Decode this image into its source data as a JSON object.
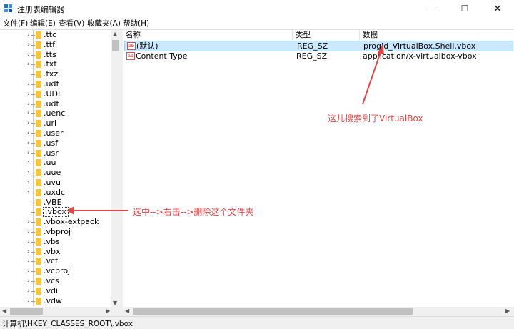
{
  "window": {
    "title": "注册表编辑器",
    "minimize_glyph": "—",
    "maximize_glyph": "☐",
    "close_glyph": "✕"
  },
  "menu": [
    {
      "label": "文件(F)"
    },
    {
      "label": "编辑(E)"
    },
    {
      "label": "查看(V)"
    },
    {
      "label": "收藏夹(A)"
    },
    {
      "label": "帮助(H)"
    }
  ],
  "tree": {
    "items": [
      {
        "label": ".ttc",
        "expandable": true
      },
      {
        "label": ".ttf",
        "expandable": true
      },
      {
        "label": ".tts",
        "expandable": true
      },
      {
        "label": ".txt",
        "expandable": true
      },
      {
        "label": ".txz",
        "expandable": false
      },
      {
        "label": ".udf",
        "expandable": true
      },
      {
        "label": ".UDL",
        "expandable": true
      },
      {
        "label": ".udt",
        "expandable": true
      },
      {
        "label": ".uenc",
        "expandable": true
      },
      {
        "label": ".url",
        "expandable": true
      },
      {
        "label": ".user",
        "expandable": true
      },
      {
        "label": ".usf",
        "expandable": true
      },
      {
        "label": ".usr",
        "expandable": true
      },
      {
        "label": ".uu",
        "expandable": true
      },
      {
        "label": ".uue",
        "expandable": true
      },
      {
        "label": ".uvu",
        "expandable": true
      },
      {
        "label": ".uxdc",
        "expandable": true
      },
      {
        "label": ".VBE",
        "expandable": false
      },
      {
        "label": ".vbox",
        "expandable": false,
        "selected": true
      },
      {
        "label": ".vbox-extpack",
        "expandable": true
      },
      {
        "label": ".vbproj",
        "expandable": true
      },
      {
        "label": ".vbs",
        "expandable": true
      },
      {
        "label": ".vbx",
        "expandable": true
      },
      {
        "label": ".vcf",
        "expandable": true
      },
      {
        "label": ".vcproj",
        "expandable": true
      },
      {
        "label": ".vcs",
        "expandable": true
      },
      {
        "label": ".vdi",
        "expandable": true
      },
      {
        "label": ".vdw",
        "expandable": true
      }
    ]
  },
  "list": {
    "columns": {
      "name": "名称",
      "type": "类型",
      "data": "数据"
    },
    "rows": [
      {
        "icon": "ab",
        "name": "(默认)",
        "type": "REG_SZ",
        "data": "progId_VirtualBox.Shell.vbox",
        "selected": true
      },
      {
        "icon": "ab",
        "name": "Content Type",
        "type": "REG_SZ",
        "data": "application/x-virtualbox-vbox",
        "selected": false
      }
    ]
  },
  "status": {
    "path": "计算机\\HKEY_CLASSES_ROOT\\.vbox"
  },
  "annotations": {
    "search_note": "这儿搜索到了VirtualBox",
    "delete_note": "选中-->右击-->删除这个文件夹",
    "color": "#e04848"
  },
  "colors": {
    "selection": "#cce8ff",
    "folder": "#f5c542"
  }
}
